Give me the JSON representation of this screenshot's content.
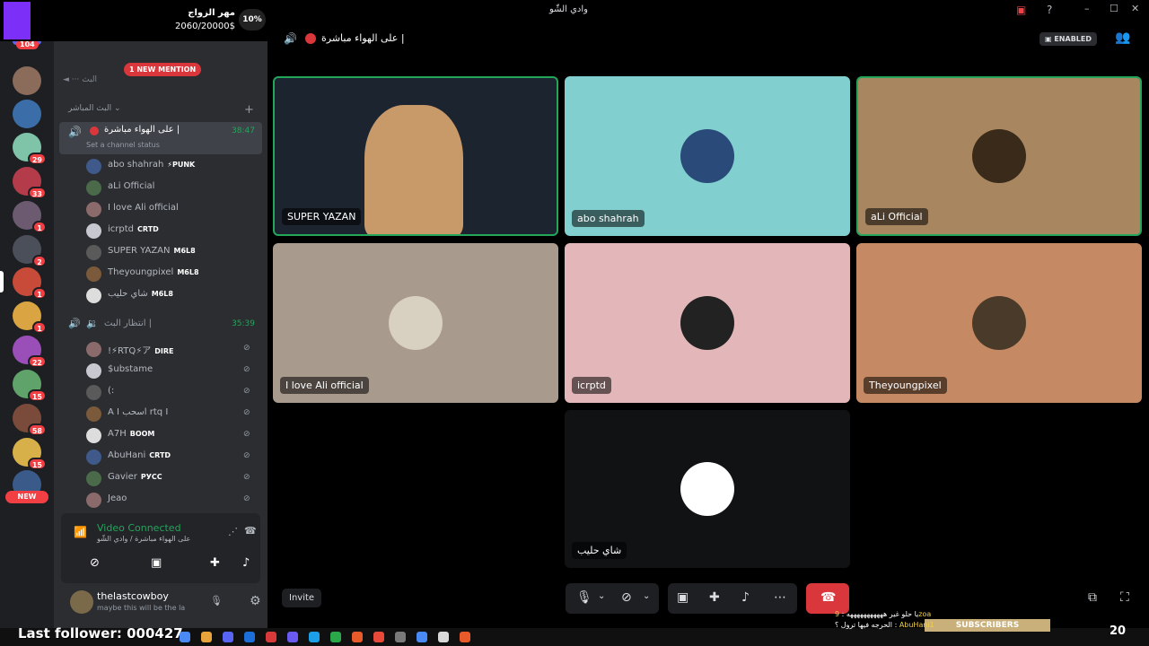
{
  "window": {
    "title": "وادي الشّو",
    "channel_header": "على الهواء مباشرة |",
    "enabled_badge": "ENABLED"
  },
  "overlay": {
    "goal_title": "مهر الزواج",
    "goal_progress_text": "2060/20000$",
    "goal_percent_label": "10%",
    "last_follower": "Last follower: 000427",
    "subscribers_label": "SUBSCRIBERS",
    "sub_count": "20",
    "chat_line1": "يا حلو غير هههههههههههه : ",
    "chat_user1": "9zoa",
    "chat_line2": "الحرجه فيها ترول ؟ : ",
    "chat_user2": "AbuHani1"
  },
  "rail": {
    "top_badge": "104",
    "badges": [
      "29",
      "33",
      "1",
      "2",
      "1",
      "1",
      "22",
      "15",
      "58",
      "15"
    ],
    "new_label": "NEW"
  },
  "channels": {
    "mention_pill": "1 NEW MENTION",
    "category": "البث المباشر",
    "live_channel_name": "على الهواء مباشرة |",
    "live_timer": "38:47",
    "set_status": "Set a channel status",
    "members_live": [
      {
        "name": "abo shahrah",
        "tag": "⚡PUNK"
      },
      {
        "name": "aLi Official",
        "tag": ""
      },
      {
        "name": "I love Ali official",
        "tag": ""
      },
      {
        "name": "icrptd",
        "tag": "CRTD"
      },
      {
        "name": "SUPER YAZAN",
        "tag": "M6L8"
      },
      {
        "name": "Theyoungpixel",
        "tag": "M6L8"
      },
      {
        "name": "شاي حليب",
        "tag": "M6L8"
      }
    ],
    "waiting_channel_name": "انتظار البث |",
    "waiting_timer": "35:39",
    "members_waiting": [
      {
        "name": "!⚡RTQ⚡ア",
        "tag": "DIRE"
      },
      {
        "name": "$ubstame",
        "tag": ""
      },
      {
        "name": "(:",
        "tag": ""
      },
      {
        "name": "A I اسحب rtq I",
        "tag": ""
      },
      {
        "name": "A7H",
        "tag": "BOOM"
      },
      {
        "name": "AbuHani",
        "tag": "CRTD"
      },
      {
        "name": "Gavier",
        "tag": "РУСС"
      },
      {
        "name": "Jeao",
        "tag": ""
      }
    ]
  },
  "voice": {
    "status": "Video Connected",
    "channel_path": "على الهواء مباشرة / وادي الشّو",
    "username": "thelastcowboy",
    "user_status": "maybe this will be the la"
  },
  "tiles": [
    {
      "name": "SUPER YAZAN",
      "bg": "#1c2430",
      "speaking": true
    },
    {
      "name": "abo shahrah",
      "bg": "#82cfd0",
      "speaking": false
    },
    {
      "name": "aLi Official",
      "bg": "#a8865f",
      "speaking": true
    },
    {
      "name": "I love Ali official",
      "bg": "#a89a8c",
      "speaking": false
    },
    {
      "name": "icrptd",
      "bg": "#e3b7b9",
      "speaking": false
    },
    {
      "name": "Theyoungpixel",
      "bg": "#c58a63",
      "speaking": false
    },
    {
      "name": "شاي حليب",
      "bg": "#111214",
      "speaking": false
    }
  ],
  "controls": {
    "invite_label": "Invite"
  },
  "colors": {
    "speaking_border": "#23a55a",
    "danger": "#da373c",
    "green": "#23a55a",
    "accent_purple": "#7b2ff7"
  }
}
